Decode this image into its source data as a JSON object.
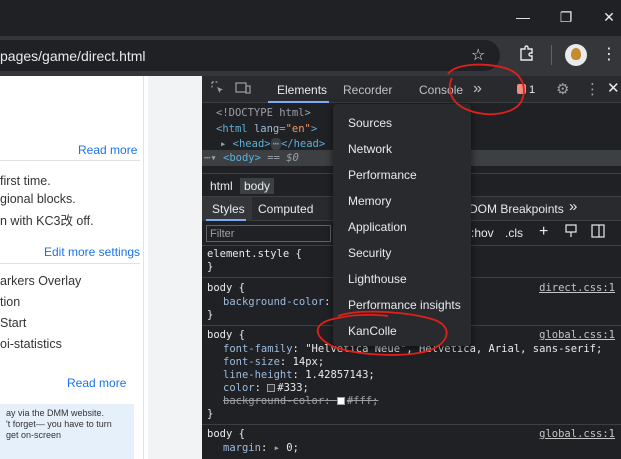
{
  "browser": {
    "url": "pages/game/direct.html",
    "window_buttons": [
      "—",
      "❐",
      "✕"
    ],
    "icons": [
      "bookmark-star-icon",
      "extensions-icon",
      "profile-avatar",
      "browser-menu-icon"
    ]
  },
  "page": {
    "read_more_1": "Read more",
    "lines_1": [
      "first time.",
      "gional blocks.",
      "n with KC3改 off."
    ],
    "edit_settings": "Edit more settings",
    "lines_2": [
      "arkers Overlay",
      "tion",
      "Start",
      "oi-statistics"
    ],
    "read_more_2": "Read more",
    "info_lines": [
      "ay via the DMM website.",
      "'t forget— you have to turn",
      "get on-screen",
      "           "
    ]
  },
  "devtools": {
    "tabs": [
      "Elements",
      "Recorder",
      "Console"
    ],
    "overflow_label": "»",
    "issues_count": "1",
    "dom": {
      "doctype": "<!DOCTYPE html>",
      "html_open": "html",
      "html_lang_attr": "lang",
      "html_lang_val": "\"en\"",
      "head": "head",
      "body": "body",
      "eq": "== $0"
    },
    "breadcrumbs": [
      "html",
      "body"
    ],
    "sub_tabs": [
      "Styles",
      "Computed",
      "DOM Breakpoints"
    ],
    "filter_placeholder": "Filter",
    "filter_tools": [
      ":hov",
      ".cls"
    ],
    "styles": {
      "element_style": "element.style {",
      "close": "}",
      "body_sel": "body {",
      "bg_color_prop": "background-color",
      "source_direct": "direct.css:1",
      "source_global": "global.css:1",
      "font_family_prop": "font-family",
      "font_family_val": "\"Helvetica Neue\", Helvetica, Arial, sans-serif;",
      "font_size_prop": "font-size",
      "font_size_val": "14px;",
      "line_height_prop": "line-height",
      "line_height_val": "1.42857143;",
      "color_prop": "color",
      "color_val": "#333;",
      "bg_struck_prop": "background-color",
      "bg_struck_val": "#fff;",
      "margin_prop": "margin",
      "margin_val": "0;"
    },
    "overflow_menu": [
      "Sources",
      "Network",
      "Performance",
      "Memory",
      "Application",
      "Security",
      "Lighthouse",
      "Performance insights",
      "KanColle"
    ]
  },
  "colors": {
    "annotation_red": "#e0201b",
    "accent_blue": "#7cacf8",
    "link_blue": "#1a73e8"
  }
}
